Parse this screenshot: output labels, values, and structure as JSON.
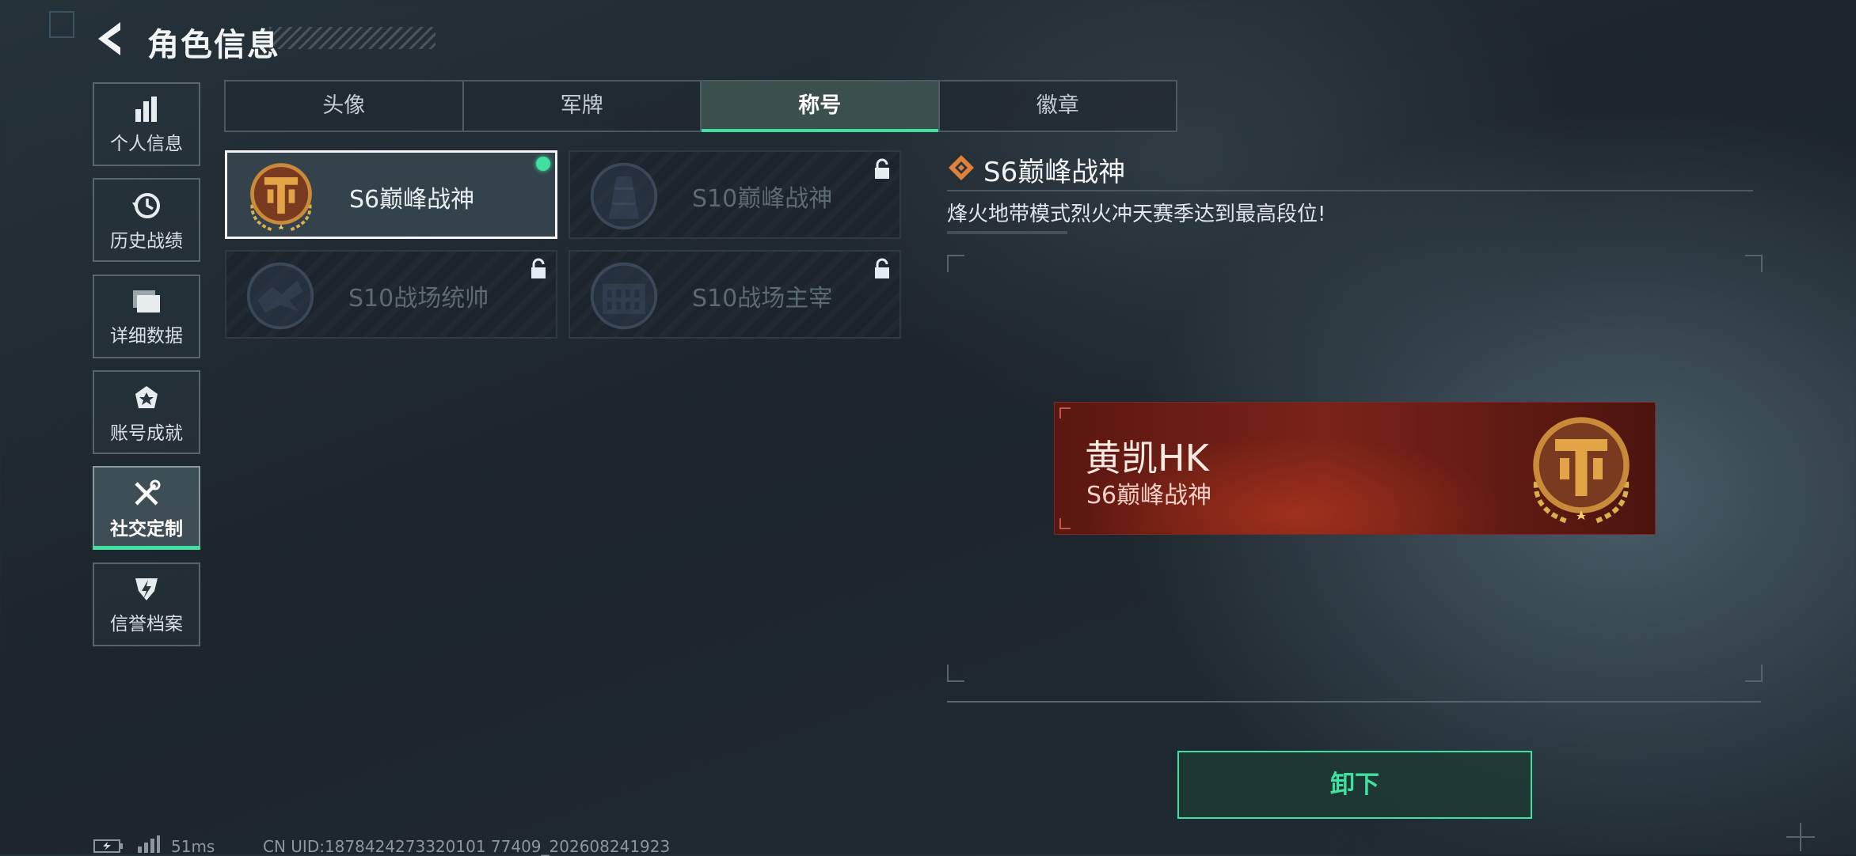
{
  "header": {
    "title": "角色信息"
  },
  "sidebar": {
    "items": [
      {
        "label": "个人信息",
        "icon": "bar-chart-icon",
        "active": false
      },
      {
        "label": "历史战绩",
        "icon": "history-icon",
        "active": false
      },
      {
        "label": "详细数据",
        "icon": "folder-icon",
        "active": false
      },
      {
        "label": "账号成就",
        "icon": "achievement-icon",
        "active": false
      },
      {
        "label": "社交定制",
        "icon": "tools-icon",
        "active": true
      },
      {
        "label": "信誉档案",
        "icon": "reputation-icon",
        "active": false
      }
    ]
  },
  "tabs": [
    {
      "label": "头像",
      "active": false
    },
    {
      "label": "军牌",
      "active": false
    },
    {
      "label": "称号",
      "active": true
    },
    {
      "label": "徽章",
      "active": false
    }
  ],
  "titles": [
    {
      "name": "S6巅峰战神",
      "locked": false,
      "equipped": true,
      "selected": true,
      "icon": "bronze-t-emblem-icon"
    },
    {
      "name": "S10巅峰战神",
      "locked": true,
      "equipped": false,
      "selected": false,
      "icon": "tower-emblem-icon"
    },
    {
      "name": "S10战场统帅",
      "locked": true,
      "equipped": false,
      "selected": false,
      "icon": "dragon-emblem-icon"
    },
    {
      "name": "S10战场主宰",
      "locked": true,
      "equipped": false,
      "selected": false,
      "icon": "colosseum-emblem-icon"
    }
  ],
  "detail": {
    "title": "S6巅峰战神",
    "description": "烽火地带模式烈火冲天赛季达到最高段位!"
  },
  "preview": {
    "player_name": "黄凯HK",
    "title": "S6巅峰战神"
  },
  "actions": {
    "unequip_label": "卸下"
  },
  "status": {
    "ping": "51ms",
    "uid": "CN UID:1878424273320101 77409_202608241923"
  },
  "colors": {
    "accent": "#3fe0a0",
    "banner_red": "#7a231a",
    "badge_bronze": "#c98a3a"
  }
}
